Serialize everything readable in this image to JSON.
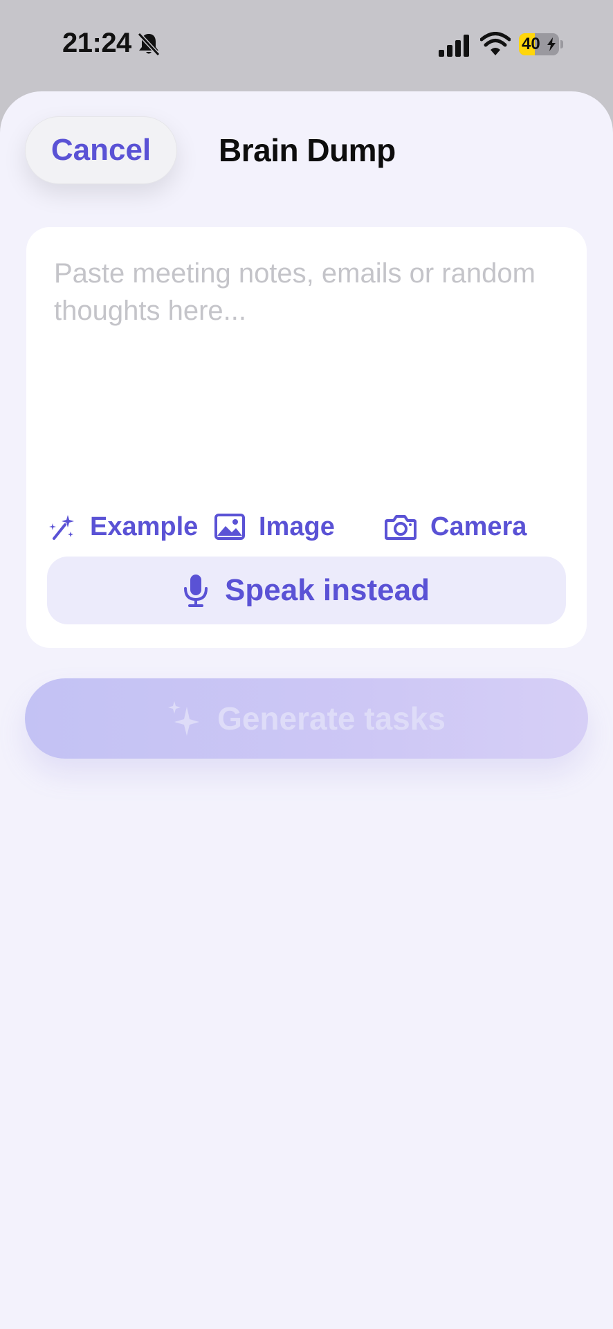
{
  "status_bar": {
    "time": "21:24",
    "battery_level": "40",
    "battery_percent": 40,
    "icons": [
      "bell-slash-icon",
      "cellular-signal-icon",
      "wifi-icon",
      "battery-charging-icon"
    ],
    "battery_color": "#ffd60a"
  },
  "header": {
    "cancel_label": "Cancel",
    "title": "Brain Dump"
  },
  "input": {
    "value": "",
    "placeholder": "Paste meeting notes, emails or random thoughts here..."
  },
  "attachments": {
    "example_label": "Example",
    "example_icon": "magic-wand-icon",
    "image_label": "Image",
    "image_icon": "photo-icon",
    "camera_label": "Camera",
    "camera_icon": "camera-icon"
  },
  "speak": {
    "label": "Speak instead",
    "icon": "microphone-icon"
  },
  "generate": {
    "label": "Generate tasks",
    "icon": "sparkles-icon",
    "enabled": false
  },
  "colors": {
    "accent": "#5a52d5",
    "sheet_background": "#f3f2fc",
    "speak_background": "#ecebfb",
    "generate_disabled": "#c6c4f5"
  }
}
